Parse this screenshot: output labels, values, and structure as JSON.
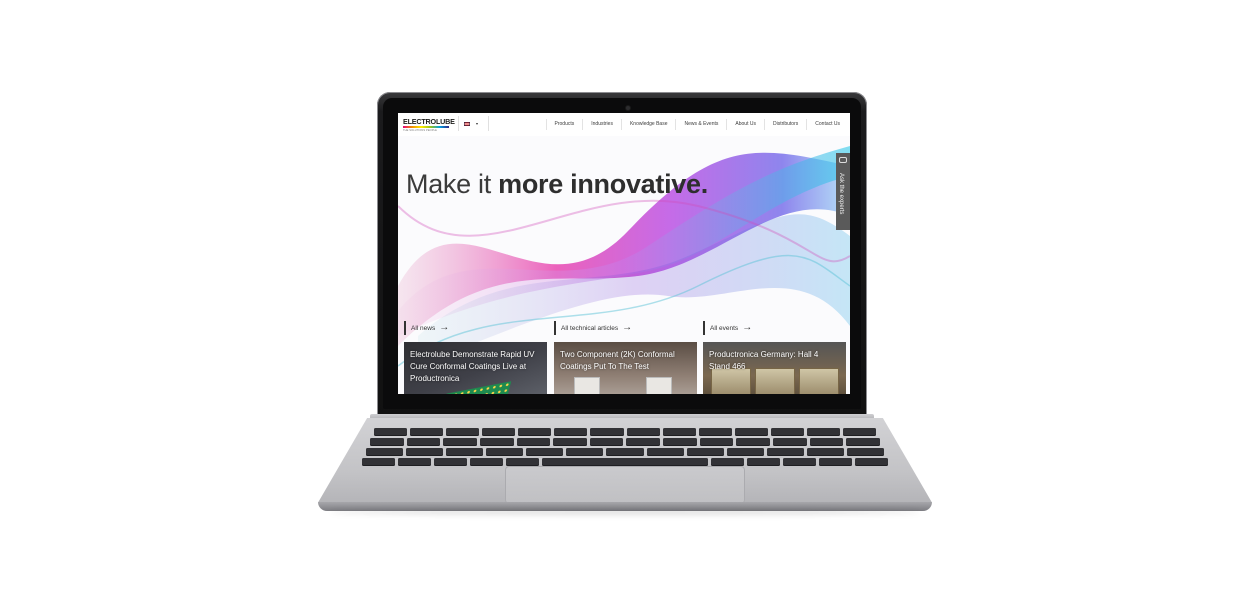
{
  "site": {
    "logo": {
      "name": "ELECTROLUBE",
      "tagline": "THE SOLUTIONS PEOPLE"
    },
    "language": {
      "icon": "uk-flag-icon",
      "caret": "▾"
    },
    "nav_items": [
      "Products",
      "Industries",
      "Knowledge Base",
      "News & Events",
      "About Us",
      "Distributors",
      "Contact Us"
    ],
    "hero": {
      "headline_light": "Make it ",
      "headline_bold": "more innovative."
    },
    "ask_experts": "Ask the experts",
    "sections": [
      {
        "label": "All news",
        "icon": "arrow-right-icon"
      },
      {
        "label": "All technical articles",
        "icon": "arrow-right-icon"
      },
      {
        "label": "All events",
        "icon": "arrow-right-icon"
      }
    ],
    "cards": [
      {
        "title": "Electrolube Demonstrate Rapid UV Cure Conformal Coatings Live at Productronica"
      },
      {
        "title": "Two Component (2K) Conformal Coatings Put To The Test"
      },
      {
        "title": "Productronica Germany: Hall 4 Stand 466"
      }
    ]
  },
  "colors": {
    "nav_text": "#3c3c3c",
    "headline": "#3b3b3b",
    "ask_tab": "#5a5a5a",
    "wave_pink": "#e62fa6",
    "wave_purple": "#7a3fd6",
    "wave_cyan": "#22c7e8"
  }
}
